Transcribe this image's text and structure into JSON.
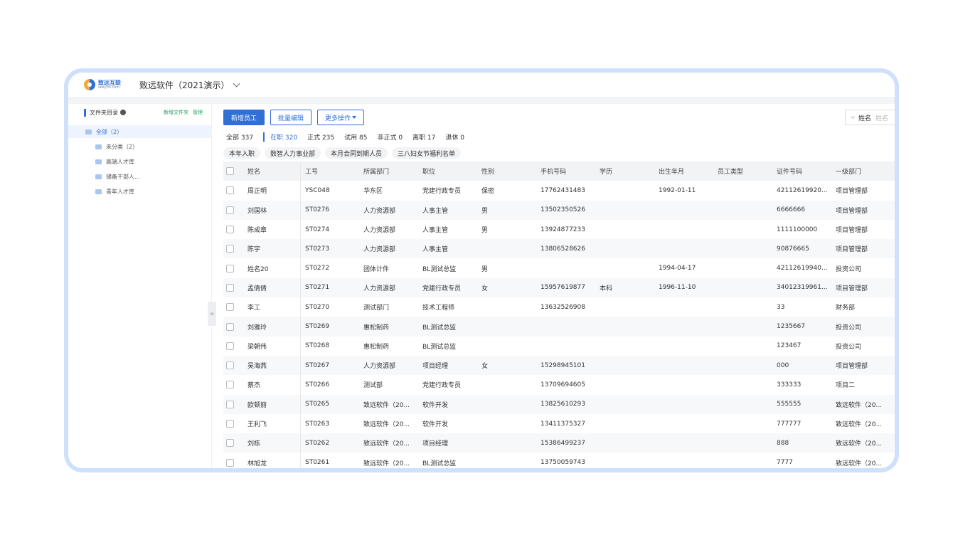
{
  "app": {
    "logo_cn": "致远互联",
    "logo_en": "seeyon.com",
    "company": "致远软件（2021演示）"
  },
  "sidebar": {
    "title": "文件夹目录",
    "new_folder": "新增文件夹",
    "manage": "管理",
    "all": "全部（2）",
    "items": [
      {
        "label": "未分类（2）"
      },
      {
        "label": "高端人才库"
      },
      {
        "label": "储备干部人..."
      },
      {
        "label": "青年人才库"
      }
    ]
  },
  "toolbar": {
    "add": "新增员工",
    "batch_edit": "批量编辑",
    "more": "更多操作"
  },
  "search": {
    "field": "姓名",
    "placeholder": "姓名"
  },
  "stats": [
    {
      "label": "全部 337"
    },
    {
      "label": "在职 320"
    },
    {
      "label": "正式 235"
    },
    {
      "label": "试用 85"
    },
    {
      "label": "非正式 0"
    },
    {
      "label": "离职 17"
    },
    {
      "label": "退休 0"
    }
  ],
  "chips": [
    {
      "label": "本年入职"
    },
    {
      "label": "数智人力事业部"
    },
    {
      "label": "本月合同到期人员"
    },
    {
      "label": "三八妇女节福利名单"
    }
  ],
  "columns": [
    "姓名",
    "工号",
    "所属部门",
    "职位",
    "性别",
    "手机号码",
    "学历",
    "出生年月",
    "员工类型",
    "证件号码",
    "一级部门"
  ],
  "rows": [
    {
      "name": "周正明",
      "no": "YSC048",
      "dept": "华东区",
      "pos": "党建行政专员",
      "sex": "保密",
      "phone": "17762431483",
      "edu": "",
      "birth": "1992-01-11",
      "type": "",
      "id": "42112619920...",
      "dept1": "项目管理部"
    },
    {
      "name": "刘国林",
      "no": "ST0276",
      "dept": "人力资源部",
      "pos": "人事主管",
      "sex": "男",
      "phone": "13502350526",
      "edu": "",
      "birth": "",
      "type": "",
      "id": "6666666",
      "dept1": "项目管理部"
    },
    {
      "name": "陈成章",
      "no": "ST0274",
      "dept": "人力资源部",
      "pos": "人事主管",
      "sex": "男",
      "phone": "13924877233",
      "edu": "",
      "birth": "",
      "type": "",
      "id": "1111100000",
      "dept1": "项目管理部"
    },
    {
      "name": "陈宇",
      "no": "ST0273",
      "dept": "人力资源部",
      "pos": "人事主管",
      "sex": "",
      "phone": "13806528626",
      "edu": "",
      "birth": "",
      "type": "",
      "id": "90876665",
      "dept1": "项目管理部"
    },
    {
      "name": "姓名20",
      "no": "ST0272",
      "dept": "团体计件",
      "pos": "BL测试总监",
      "sex": "男",
      "phone": "",
      "edu": "",
      "birth": "1994-04-17",
      "type": "",
      "id": "42112619940...",
      "dept1": "投资公司"
    },
    {
      "name": "孟倩倩",
      "no": "ST0271",
      "dept": "人力资源部",
      "pos": "党建行政专员",
      "sex": "女",
      "phone": "15957619877",
      "edu": "本科",
      "birth": "1996-11-10",
      "type": "",
      "id": "34012319961...",
      "dept1": "项目管理部"
    },
    {
      "name": "李工",
      "no": "ST0270",
      "dept": "测试部门",
      "pos": "技术工程师",
      "sex": "",
      "phone": "13632526908",
      "edu": "",
      "birth": "",
      "type": "",
      "id": "33",
      "dept1": "财务部"
    },
    {
      "name": "刘雅玲",
      "no": "ST0269",
      "dept": "惠松制药",
      "pos": "BL测试总监",
      "sex": "",
      "phone": "",
      "edu": "",
      "birth": "",
      "type": "",
      "id": "1235667",
      "dept1": "投资公司"
    },
    {
      "name": "梁朝伟",
      "no": "ST0268",
      "dept": "惠松制药",
      "pos": "BL测试总监",
      "sex": "",
      "phone": "",
      "edu": "",
      "birth": "",
      "type": "",
      "id": "123467",
      "dept1": "投资公司"
    },
    {
      "name": "吴海燕",
      "no": "ST0267",
      "dept": "人力资源部",
      "pos": "项目经理",
      "sex": "女",
      "phone": "15298945101",
      "edu": "",
      "birth": "",
      "type": "",
      "id": "000",
      "dept1": "项目管理部"
    },
    {
      "name": "蔡杰",
      "no": "ST0266",
      "dept": "测试部",
      "pos": "党建行政专员",
      "sex": "",
      "phone": "13709694605",
      "edu": "",
      "birth": "",
      "type": "",
      "id": "333333",
      "dept1": "项目二"
    },
    {
      "name": "欧顿丽",
      "no": "ST0265",
      "dept": "致远软件（20...",
      "pos": "软件开发",
      "sex": "",
      "phone": "13825610293",
      "edu": "",
      "birth": "",
      "type": "",
      "id": "555555",
      "dept1": "致远软件（20..."
    },
    {
      "name": "王利飞",
      "no": "ST0263",
      "dept": "致远软件（20...",
      "pos": "软件开发",
      "sex": "",
      "phone": "13411375327",
      "edu": "",
      "birth": "",
      "type": "",
      "id": "777777",
      "dept1": "致远软件（20..."
    },
    {
      "name": "刘栋",
      "no": "ST0262",
      "dept": "致远软件（20...",
      "pos": "项目经理",
      "sex": "",
      "phone": "15386499237",
      "edu": "",
      "birth": "",
      "type": "",
      "id": "888",
      "dept1": "致远软件（20..."
    },
    {
      "name": "林旭龙",
      "no": "ST0261",
      "dept": "致远软件（20...",
      "pos": "BL测试总监",
      "sex": "",
      "phone": "13750059743",
      "edu": "",
      "birth": "",
      "type": "",
      "id": "7777",
      "dept1": "致远软件（20..."
    }
  ]
}
